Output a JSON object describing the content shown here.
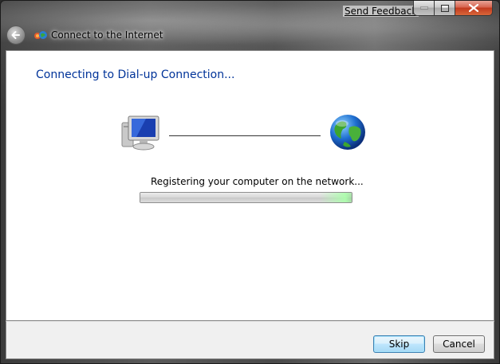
{
  "titlebar": {
    "title": "Connect to the Internet",
    "send_feedback": "Send Feedback",
    "app_icon": "network-connect-icon",
    "back_icon": "back-arrow-icon",
    "caption_icons": [
      "minimize-icon",
      "maximize-icon",
      "close-icon"
    ]
  },
  "main": {
    "heading": "Connecting to Dial-up Connection...",
    "status": "Registering your computer on the network...",
    "progress": 1.0,
    "left_icon": "computer-icon",
    "right_icon": "globe-icon"
  },
  "footer": {
    "skip_label": "Skip",
    "cancel_label": "Cancel"
  },
  "colors": {
    "heading": "#003399",
    "skip_border": "#3c7fb1",
    "close_button": "#c23a1f"
  }
}
